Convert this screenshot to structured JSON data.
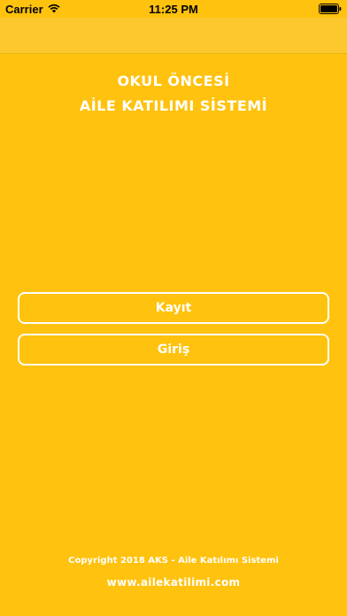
{
  "status_bar": {
    "carrier": "Carrier",
    "time": "11:25 PM"
  },
  "title": {
    "line1": "OKUL ÖNCESİ",
    "line2": "AİLE KATILIMI SİSTEMİ"
  },
  "buttons": {
    "register": "Kayıt",
    "login": "Giriş"
  },
  "footer": {
    "copyright": "Copyright 2018 AKS - Aile Katılımı Sistemi",
    "website": "www.ailekatilimi.com"
  },
  "colors": {
    "background": "#FFC20E",
    "text": "#FFFFFF"
  }
}
